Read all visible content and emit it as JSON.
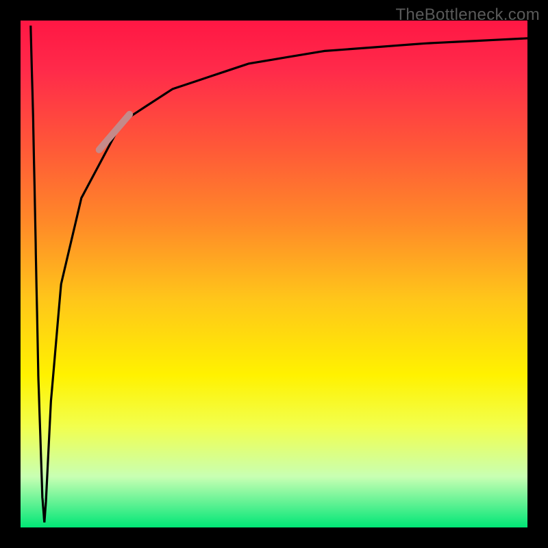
{
  "watermark": "TheBottleneck.com",
  "chart_data": {
    "type": "line",
    "title": "",
    "xlabel": "",
    "ylabel": "",
    "xlim": [
      0,
      100
    ],
    "ylim": [
      0,
      100
    ],
    "background_gradient_stops_pct_to_color": [
      [
        0,
        "#ff1744"
      ],
      [
        25,
        "#ff5838"
      ],
      [
        55,
        "#ffc61a"
      ],
      [
        70,
        "#fff200"
      ],
      [
        100,
        "#00e676"
      ]
    ],
    "series": [
      {
        "name": "main-curve",
        "color": "#000000",
        "points_xy_pct": [
          [
            2.0,
            99.0
          ],
          [
            2.5,
            80.0
          ],
          [
            3.0,
            55.0
          ],
          [
            3.5,
            30.0
          ],
          [
            4.3,
            6.0
          ],
          [
            4.7,
            1.0
          ],
          [
            5.0,
            5.0
          ],
          [
            6.0,
            25.0
          ],
          [
            8.0,
            48.0
          ],
          [
            12.0,
            65.0
          ],
          [
            20.0,
            80.0
          ],
          [
            30.0,
            86.5
          ],
          [
            45.0,
            91.5
          ],
          [
            60.0,
            94.0
          ],
          [
            80.0,
            95.5
          ],
          [
            100.0,
            96.5
          ]
        ]
      },
      {
        "name": "highlight-segment",
        "color": "#c48a8a",
        "points_xy_pct": [
          [
            15.5,
            74.5
          ],
          [
            21.5,
            81.5
          ]
        ]
      }
    ]
  }
}
